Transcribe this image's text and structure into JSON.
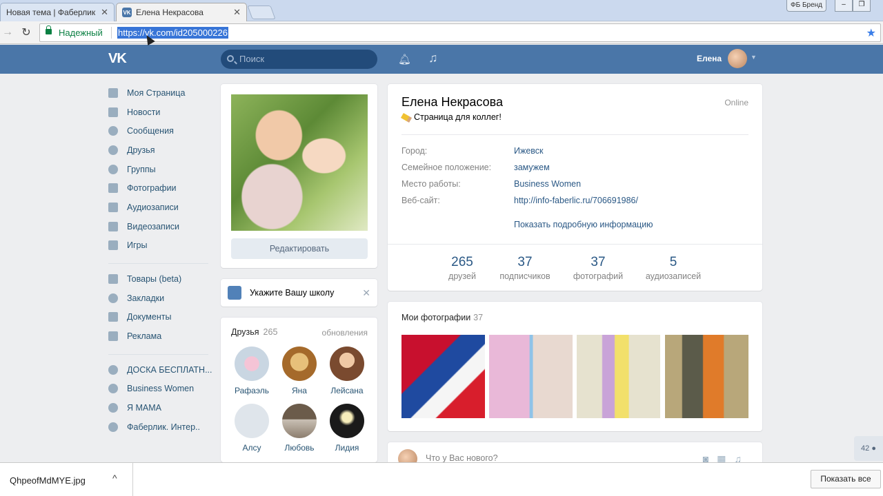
{
  "browser": {
    "tabs": [
      {
        "label": "Новая тема | Фаберлик"
      },
      {
        "label": "Елена Некрасова",
        "favicon": "vk-icon"
      }
    ],
    "profile_button": "ФБ Бренд",
    "address": {
      "secure_label": "Надежный",
      "url": "https://vk.com/id205000226"
    }
  },
  "vk_header": {
    "logo": "VK",
    "search_placeholder": "Поиск",
    "user_name": "Елена",
    "accent_color": "#4a76a8"
  },
  "left_menu": {
    "main": [
      {
        "label": "Моя Страница",
        "icon": "home-icon"
      },
      {
        "label": "Новости",
        "icon": "news-icon"
      },
      {
        "label": "Сообщения",
        "icon": "message-icon"
      },
      {
        "label": "Друзья",
        "icon": "user-icon"
      },
      {
        "label": "Группы",
        "icon": "group-icon"
      },
      {
        "label": "Фотографии",
        "icon": "camera-icon"
      },
      {
        "label": "Аудиозаписи",
        "icon": "music-icon"
      },
      {
        "label": "Видеозаписи",
        "icon": "video-icon"
      },
      {
        "label": "Игры",
        "icon": "gamepad-icon"
      }
    ],
    "extra": [
      {
        "label": "Товары (beta)",
        "icon": "bag-icon"
      },
      {
        "label": "Закладки",
        "icon": "star-icon"
      },
      {
        "label": "Документы",
        "icon": "document-icon"
      },
      {
        "label": "Реклама",
        "icon": "megaphone-icon"
      }
    ],
    "groups": [
      {
        "label": "ДОСКА БЕСПЛАТН..."
      },
      {
        "label": "Business Women"
      },
      {
        "label": "Я МАМА"
      },
      {
        "label": "Фаберлик. Интер.."
      }
    ]
  },
  "profile_card": {
    "edit_label": "Редактировать"
  },
  "school_card": {
    "text": "Укажите Вашу школу"
  },
  "friends_card": {
    "title": "Друзья",
    "count": "265",
    "updates": "обновления",
    "friends": [
      {
        "name": "Рафаэль"
      },
      {
        "name": "Яна"
      },
      {
        "name": "Лейсана"
      },
      {
        "name": "Алсу"
      },
      {
        "name": "Любовь"
      },
      {
        "name": "Лидия"
      }
    ]
  },
  "profile": {
    "name": "Елена Некрасова",
    "status": "Страница для коллег!",
    "online": "Online",
    "info": [
      {
        "label": "Город:",
        "value": "Ижевск"
      },
      {
        "label": "Семейное положение:",
        "value": "замужем"
      },
      {
        "label": "Место работы:",
        "value": "Business Women"
      },
      {
        "label": "Веб-сайт:",
        "value": "http://info-faberlic.ru/706691986/"
      }
    ],
    "more_info": "Показать подробную информацию",
    "counters": [
      {
        "num": "265",
        "label": "друзей"
      },
      {
        "num": "37",
        "label": "подписчиков"
      },
      {
        "num": "37",
        "label": "фотографий"
      },
      {
        "num": "5",
        "label": "аудиозаписей"
      }
    ]
  },
  "photos_card": {
    "title": "Мои фотографии",
    "count": "37"
  },
  "post_box": {
    "placeholder": "Что у Вас нового?"
  },
  "side_badge": "42",
  "download_bar": {
    "file_name": "QhpeofMdMYE.jpg",
    "show_all": "Показать все"
  }
}
